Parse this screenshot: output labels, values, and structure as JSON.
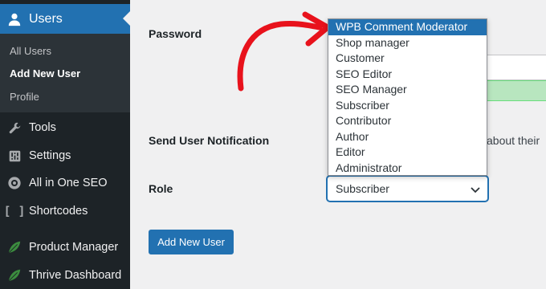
{
  "sidebar": {
    "active_menu": "Users",
    "submenu": [
      "All Users",
      "Add New User",
      "Profile"
    ],
    "current_submenu": "Add New User",
    "items": [
      {
        "label": "Tools",
        "icon": "wrench-icon"
      },
      {
        "label": "Settings",
        "icon": "sliders-icon"
      },
      {
        "label": "All in One SEO",
        "icon": "seo-gear-icon"
      },
      {
        "label": "Shortcodes",
        "icon": "brackets-icon"
      },
      {
        "label": "Product Manager",
        "icon": "leaf-icon"
      },
      {
        "label": "Thrive Dashboard",
        "icon": "leaf-icon"
      }
    ]
  },
  "form": {
    "password_label": "Password",
    "notification_label": "Send User Notification",
    "notification_text": "about their",
    "role_label": "Role",
    "role_value": "Subscriber",
    "submit_label": "Add New User"
  },
  "role_dropdown": {
    "options": [
      "WPB Comment Moderator",
      "Shop manager",
      "Customer",
      "SEO Editor",
      "SEO Manager",
      "Subscriber",
      "Contributor",
      "Author",
      "Editor",
      "Administrator"
    ],
    "highlighted": "WPB Comment Moderator"
  },
  "colors": {
    "sidebar_bg": "#1d2327",
    "accent": "#2271b1",
    "annotation_arrow": "#e8121c"
  }
}
